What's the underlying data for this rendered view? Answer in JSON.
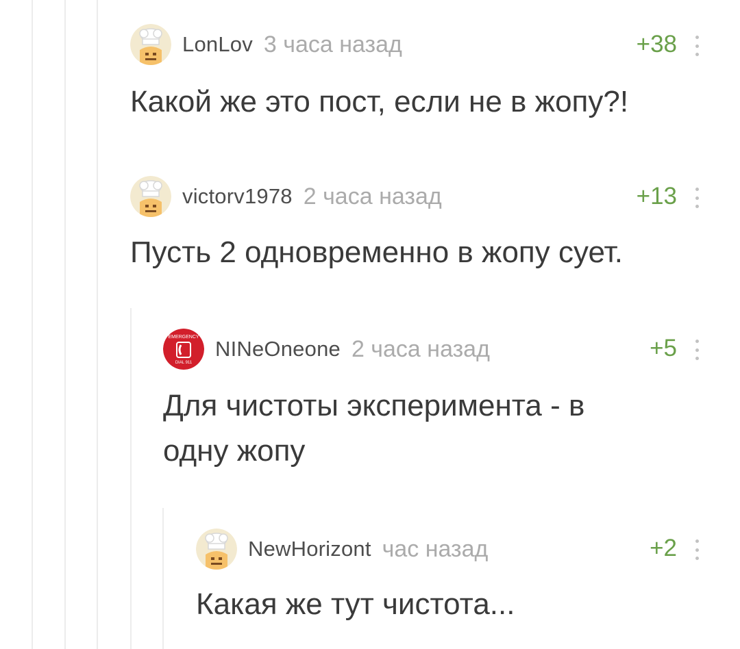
{
  "comments": [
    {
      "username": "LonLov",
      "time": "3 часа назад",
      "score": "+38",
      "text": "Какой же это пост, если не в жопу?!",
      "avatar": "default-chef-avatar"
    },
    {
      "username": "victorv1978",
      "time": "2 часа назад",
      "score": "+13",
      "text": "Пусть 2 одновременно в жопу сует.",
      "avatar": "default-chef-avatar"
    },
    {
      "username": "NINeOneone",
      "time": "2 часа назад",
      "score": "+5",
      "text_lines": [
        "Для чистоты эксперимента - в",
        "одну жопу"
      ],
      "avatar": "emergency-dial-911-avatar",
      "avatar_text_top": "EMERGENCY",
      "avatar_text_bottom": "DIAL 911"
    },
    {
      "username": "NewHorizont",
      "time": "час назад",
      "score": "+2",
      "text": "Какая же тут чистота...",
      "avatar": "default-chef-avatar"
    }
  ],
  "colors": {
    "score": "#6aa04a",
    "username": "#4d4d4d",
    "time": "#ababab",
    "text": "#3a3a3a",
    "thread_line": "#ececec"
  }
}
